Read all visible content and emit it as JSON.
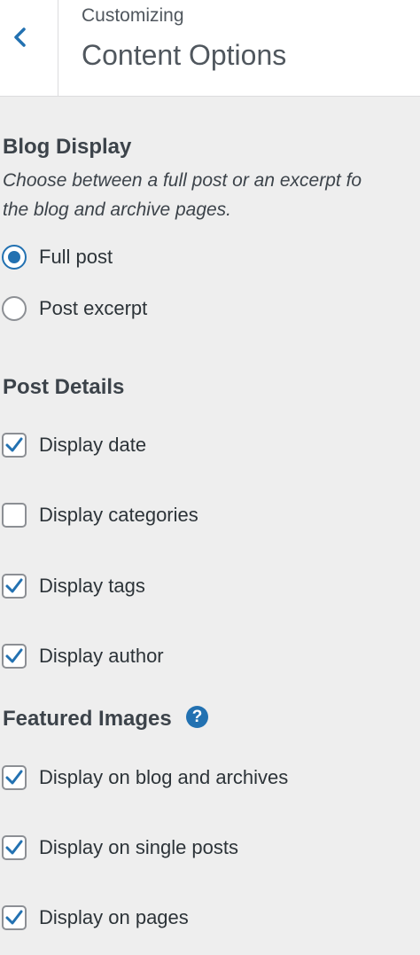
{
  "header": {
    "small_label": "Customizing",
    "title": "Content Options",
    "back_icon": "chevron-left-icon"
  },
  "blog_display": {
    "title": "Blog Display",
    "description_line1": "Choose between a full post or an excerpt fo",
    "description_line2": "the blog and archive pages.",
    "options": [
      {
        "label": "Full post",
        "selected": true
      },
      {
        "label": "Post excerpt",
        "selected": false
      }
    ]
  },
  "post_details": {
    "title": "Post Details",
    "options": [
      {
        "label": "Display date",
        "checked": true
      },
      {
        "label": "Display categories",
        "checked": false
      },
      {
        "label": "Display tags",
        "checked": true
      },
      {
        "label": "Display author",
        "checked": true
      }
    ]
  },
  "featured_images": {
    "title": "Featured Images",
    "help_glyph": "?",
    "options": [
      {
        "label": "Display on blog and archives",
        "checked": true
      },
      {
        "label": "Display on single posts",
        "checked": true
      },
      {
        "label": "Display on pages",
        "checked": true
      }
    ]
  },
  "colors": {
    "accent": "#2271b1",
    "border": "#8c8f94",
    "panel_bg": "#eeeeee"
  }
}
